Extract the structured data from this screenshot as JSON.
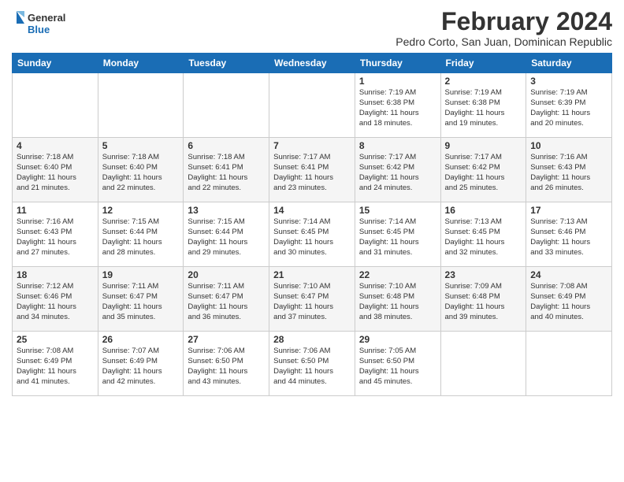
{
  "header": {
    "logo_general": "General",
    "logo_blue": "Blue",
    "title": "February 2024",
    "subtitle": "Pedro Corto, San Juan, Dominican Republic"
  },
  "days_of_week": [
    "Sunday",
    "Monday",
    "Tuesday",
    "Wednesday",
    "Thursday",
    "Friday",
    "Saturday"
  ],
  "weeks": [
    [
      {
        "day": "",
        "info": ""
      },
      {
        "day": "",
        "info": ""
      },
      {
        "day": "",
        "info": ""
      },
      {
        "day": "",
        "info": ""
      },
      {
        "day": "1",
        "info": "Sunrise: 7:19 AM\nSunset: 6:38 PM\nDaylight: 11 hours\nand 18 minutes."
      },
      {
        "day": "2",
        "info": "Sunrise: 7:19 AM\nSunset: 6:38 PM\nDaylight: 11 hours\nand 19 minutes."
      },
      {
        "day": "3",
        "info": "Sunrise: 7:19 AM\nSunset: 6:39 PM\nDaylight: 11 hours\nand 20 minutes."
      }
    ],
    [
      {
        "day": "4",
        "info": "Sunrise: 7:18 AM\nSunset: 6:40 PM\nDaylight: 11 hours\nand 21 minutes."
      },
      {
        "day": "5",
        "info": "Sunrise: 7:18 AM\nSunset: 6:40 PM\nDaylight: 11 hours\nand 22 minutes."
      },
      {
        "day": "6",
        "info": "Sunrise: 7:18 AM\nSunset: 6:41 PM\nDaylight: 11 hours\nand 22 minutes."
      },
      {
        "day": "7",
        "info": "Sunrise: 7:17 AM\nSunset: 6:41 PM\nDaylight: 11 hours\nand 23 minutes."
      },
      {
        "day": "8",
        "info": "Sunrise: 7:17 AM\nSunset: 6:42 PM\nDaylight: 11 hours\nand 24 minutes."
      },
      {
        "day": "9",
        "info": "Sunrise: 7:17 AM\nSunset: 6:42 PM\nDaylight: 11 hours\nand 25 minutes."
      },
      {
        "day": "10",
        "info": "Sunrise: 7:16 AM\nSunset: 6:43 PM\nDaylight: 11 hours\nand 26 minutes."
      }
    ],
    [
      {
        "day": "11",
        "info": "Sunrise: 7:16 AM\nSunset: 6:43 PM\nDaylight: 11 hours\nand 27 minutes."
      },
      {
        "day": "12",
        "info": "Sunrise: 7:15 AM\nSunset: 6:44 PM\nDaylight: 11 hours\nand 28 minutes."
      },
      {
        "day": "13",
        "info": "Sunrise: 7:15 AM\nSunset: 6:44 PM\nDaylight: 11 hours\nand 29 minutes."
      },
      {
        "day": "14",
        "info": "Sunrise: 7:14 AM\nSunset: 6:45 PM\nDaylight: 11 hours\nand 30 minutes."
      },
      {
        "day": "15",
        "info": "Sunrise: 7:14 AM\nSunset: 6:45 PM\nDaylight: 11 hours\nand 31 minutes."
      },
      {
        "day": "16",
        "info": "Sunrise: 7:13 AM\nSunset: 6:45 PM\nDaylight: 11 hours\nand 32 minutes."
      },
      {
        "day": "17",
        "info": "Sunrise: 7:13 AM\nSunset: 6:46 PM\nDaylight: 11 hours\nand 33 minutes."
      }
    ],
    [
      {
        "day": "18",
        "info": "Sunrise: 7:12 AM\nSunset: 6:46 PM\nDaylight: 11 hours\nand 34 minutes."
      },
      {
        "day": "19",
        "info": "Sunrise: 7:11 AM\nSunset: 6:47 PM\nDaylight: 11 hours\nand 35 minutes."
      },
      {
        "day": "20",
        "info": "Sunrise: 7:11 AM\nSunset: 6:47 PM\nDaylight: 11 hours\nand 36 minutes."
      },
      {
        "day": "21",
        "info": "Sunrise: 7:10 AM\nSunset: 6:47 PM\nDaylight: 11 hours\nand 37 minutes."
      },
      {
        "day": "22",
        "info": "Sunrise: 7:10 AM\nSunset: 6:48 PM\nDaylight: 11 hours\nand 38 minutes."
      },
      {
        "day": "23",
        "info": "Sunrise: 7:09 AM\nSunset: 6:48 PM\nDaylight: 11 hours\nand 39 minutes."
      },
      {
        "day": "24",
        "info": "Sunrise: 7:08 AM\nSunset: 6:49 PM\nDaylight: 11 hours\nand 40 minutes."
      }
    ],
    [
      {
        "day": "25",
        "info": "Sunrise: 7:08 AM\nSunset: 6:49 PM\nDaylight: 11 hours\nand 41 minutes."
      },
      {
        "day": "26",
        "info": "Sunrise: 7:07 AM\nSunset: 6:49 PM\nDaylight: 11 hours\nand 42 minutes."
      },
      {
        "day": "27",
        "info": "Sunrise: 7:06 AM\nSunset: 6:50 PM\nDaylight: 11 hours\nand 43 minutes."
      },
      {
        "day": "28",
        "info": "Sunrise: 7:06 AM\nSunset: 6:50 PM\nDaylight: 11 hours\nand 44 minutes."
      },
      {
        "day": "29",
        "info": "Sunrise: 7:05 AM\nSunset: 6:50 PM\nDaylight: 11 hours\nand 45 minutes."
      },
      {
        "day": "",
        "info": ""
      },
      {
        "day": "",
        "info": ""
      }
    ]
  ]
}
